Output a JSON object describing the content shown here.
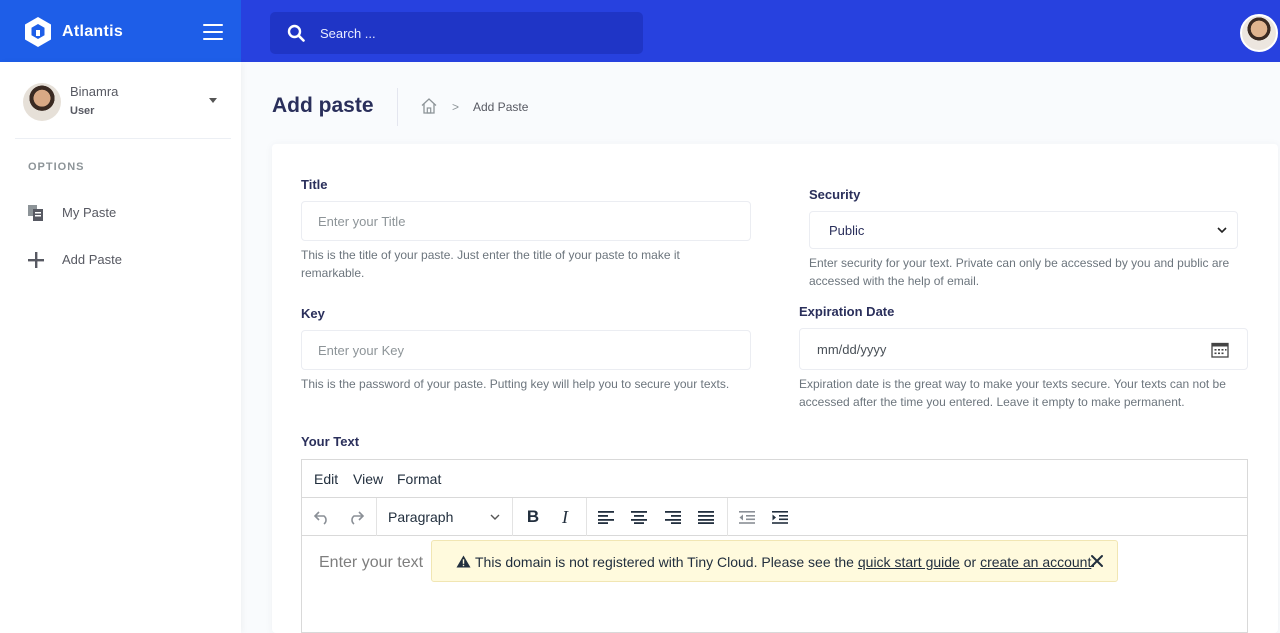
{
  "app": {
    "name": "Atlantis"
  },
  "search": {
    "placeholder": "Search ..."
  },
  "user": {
    "name": "Binamra",
    "role": "User"
  },
  "sidebar": {
    "section_label": "OPTIONS",
    "items": [
      {
        "label": "My Paste",
        "icon": "copy-icon"
      },
      {
        "label": "Add Paste",
        "icon": "plus-icon"
      }
    ]
  },
  "page": {
    "title": "Add paste",
    "breadcrumb": {
      "current": "Add Paste"
    }
  },
  "form": {
    "title": {
      "label": "Title",
      "placeholder": "Enter your Title",
      "help": "This is the title of your paste. Just enter the title of your paste to make it remarkable."
    },
    "security": {
      "label": "Security",
      "value": "Public",
      "help": "Enter security for your text. Private can only be accessed by you and public are accessed with the help of email."
    },
    "key": {
      "label": "Key",
      "placeholder": "Enter your Key",
      "help": "This is the password of your paste. Putting key will help you to secure your texts."
    },
    "expiration": {
      "label": "Expiration Date",
      "value": "mm/dd/yyyy",
      "help": "Expiration date is the great way to make your texts secure. Your texts can not be accessed after the time you entered. Leave it empty to make permanent."
    },
    "text": {
      "label": "Your Text"
    }
  },
  "editor": {
    "menu": [
      "Edit",
      "View",
      "Format"
    ],
    "block_format": "Paragraph",
    "placeholder": "Enter your text",
    "notice": {
      "prefix": "This domain is not registered with Tiny Cloud. Please see the ",
      "link1": "quick start guide",
      "middle": " or ",
      "link2": "create an account",
      "suffix": "."
    }
  },
  "colors": {
    "topbar": "#2741df",
    "logo_bg": "#1e5ee8",
    "search_bg": "#1f35c6",
    "notice_bg": "#fffadd"
  }
}
